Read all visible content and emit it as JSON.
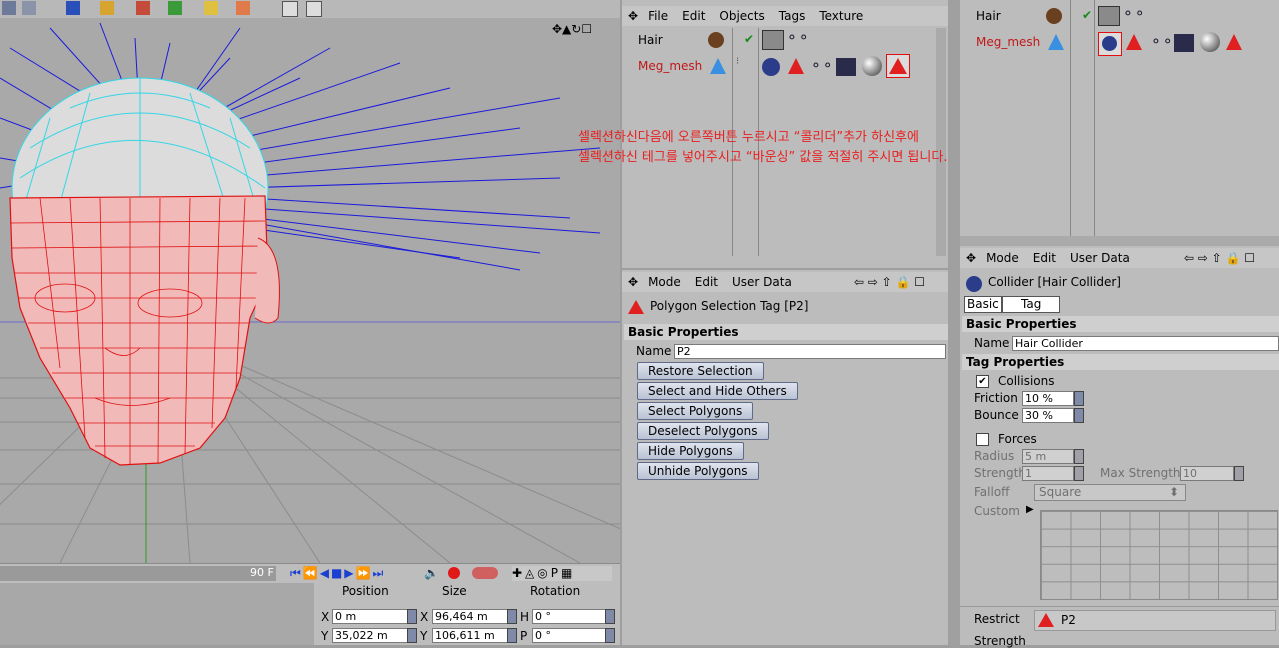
{
  "viewport": {
    "frame_label": "90 F",
    "annotation_line1": "셀렉션하신다음에 오른쪽버튼 누르시고 “콜리더”추가 하신후에",
    "annotation_line2": "셀렉션하신 테그를 넣어주시고 “바운싱” 값을 적절히 주시면 됩니다."
  },
  "coords": {
    "headers": [
      "Position",
      "Size",
      "Rotation"
    ],
    "position_x_label": "X",
    "position_x": "0 m",
    "position_y_label": "Y",
    "position_y": "35,022 m",
    "size_x_label": "X",
    "size_x": "96,464 m",
    "size_y_label": "Y",
    "size_y": "106,611 m",
    "rot_h_label": "H",
    "rot_h": "0 °",
    "rot_p_label": "P",
    "rot_p": "0 °"
  },
  "object_manager": {
    "menu": [
      "File",
      "Edit",
      "Objects",
      "Tags",
      "Texture"
    ],
    "objects": [
      "Hair",
      "Meg_mesh"
    ]
  },
  "attr_manager_mid": {
    "menu": [
      "Mode",
      "Edit",
      "User Data"
    ],
    "title": "Polygon Selection Tag [P2]",
    "section": "Basic Properties",
    "name_label": "Name",
    "name_value": "P2",
    "buttons": [
      "Restore Selection",
      "Select and Hide Others",
      "Select Polygons",
      "Deselect Polygons",
      "Hide Polygons",
      "Unhide Polygons"
    ]
  },
  "object_manager_right": {
    "objects": [
      "Hair",
      "Meg_mesh"
    ]
  },
  "attr_manager_right": {
    "menu": [
      "Mode",
      "Edit",
      "User Data"
    ],
    "title": "Collider [Hair Collider]",
    "tabs": [
      "Basic",
      "Tag"
    ],
    "basic_section": "Basic Properties",
    "name_label": "Name",
    "name_value": "Hair Collider",
    "tag_section": "Tag Properties",
    "collisions_label": "Collisions",
    "friction_label": "Friction",
    "friction_value": "10 %",
    "bounce_label": "Bounce",
    "bounce_value": "30 %",
    "forces_label": "Forces",
    "radius_label": "Radius",
    "radius_value": "5 m",
    "strength_label": "Strength",
    "strength_value": "1",
    "max_strength_label": "Max Strength",
    "max_strength_value": "10",
    "falloff_label": "Falloff",
    "falloff_value": "Square",
    "custom_label": "Custom",
    "restrict_label": "Restrict",
    "restrict_value": "P2",
    "strength2_label": "Strength"
  }
}
